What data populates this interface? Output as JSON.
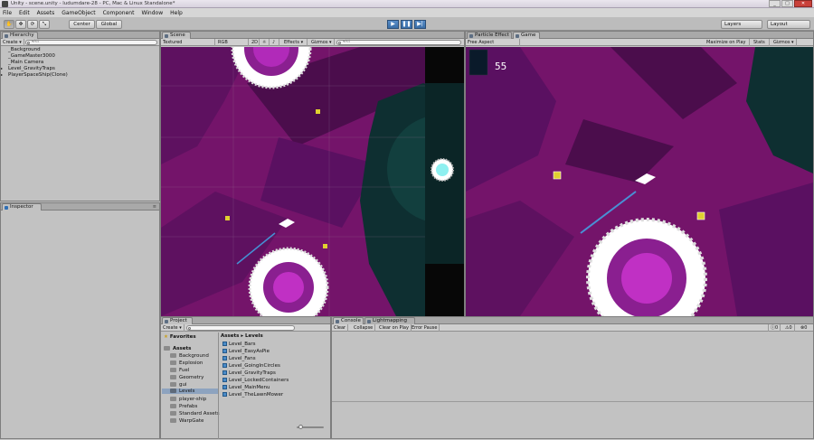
{
  "window": {
    "title": "Unity - scene.unity - ludumdare-28 - PC, Mac & Linux Standalone*",
    "min": "_",
    "max": "□",
    "close": "✕"
  },
  "menu": [
    "File",
    "Edit",
    "Assets",
    "GameObject",
    "Component",
    "Window",
    "Help"
  ],
  "toolbar": {
    "tools": [
      "✋",
      "✥",
      "⟳",
      "⤡"
    ],
    "pivot": "Center",
    "space": "Global",
    "play": "▶",
    "pause": "❚❚",
    "step": "▶|",
    "layers": "Layers",
    "layout": "Layout"
  },
  "hierarchy": {
    "tab": "Hierarchy",
    "create": "Create ▾",
    "search_placeholder": "▾All",
    "items": [
      "_Background",
      "_GameMaster3000",
      "_Main Camera",
      "Level_GravityTraps",
      "PlayerSpaceShip(Clone)"
    ]
  },
  "inspector": {
    "tab": "Inspector"
  },
  "scene": {
    "tab": "Scene",
    "shading": "Textured",
    "render": "RGB",
    "mode_2d": "2D",
    "effects": "Effects ▾",
    "gizmos": "Gizmos ▾",
    "search_placeholder": "▾All"
  },
  "game": {
    "tab_particle": "Particle Effect",
    "tab_game": "Game",
    "aspect": "Free Aspect",
    "maximize": "Maximize on Play",
    "stats": "Stats",
    "gizmos": "Gizmos ▾",
    "score": "55"
  },
  "project": {
    "tab": "Project",
    "create": "Create ▾",
    "favorites": "Favorites",
    "assets": "Assets",
    "folders": [
      "Background",
      "Explosion",
      "Fuel",
      "Geometry",
      "gui",
      "Levels",
      "player-ship",
      "Prefabs",
      "Standard Assets",
      "WarpGate"
    ],
    "selected_folder": "Levels",
    "breadcrumb_root": "Assets",
    "breadcrumb_sep": "▸",
    "breadcrumb_leaf": "Levels",
    "files": [
      "Level_Bars",
      "Level_EasyAsPie",
      "Level_Fans",
      "Level_GoingInCircles",
      "Level_GravityTraps",
      "Level_LockedContainers",
      "Level_MainMenu",
      "Level_TheLawnMower"
    ]
  },
  "console": {
    "tab": "Console",
    "tab2": "Lightmapping",
    "buttons": [
      "Clear",
      "Collapse",
      "Clear on Play",
      "Error Pause"
    ],
    "counts": [
      "0",
      "0",
      "0"
    ]
  },
  "colors": {
    "magenta": "#74146a",
    "magenta_dark": "#3d0b3c",
    "teal": "#0d3b3a",
    "white": "#ffffff"
  }
}
